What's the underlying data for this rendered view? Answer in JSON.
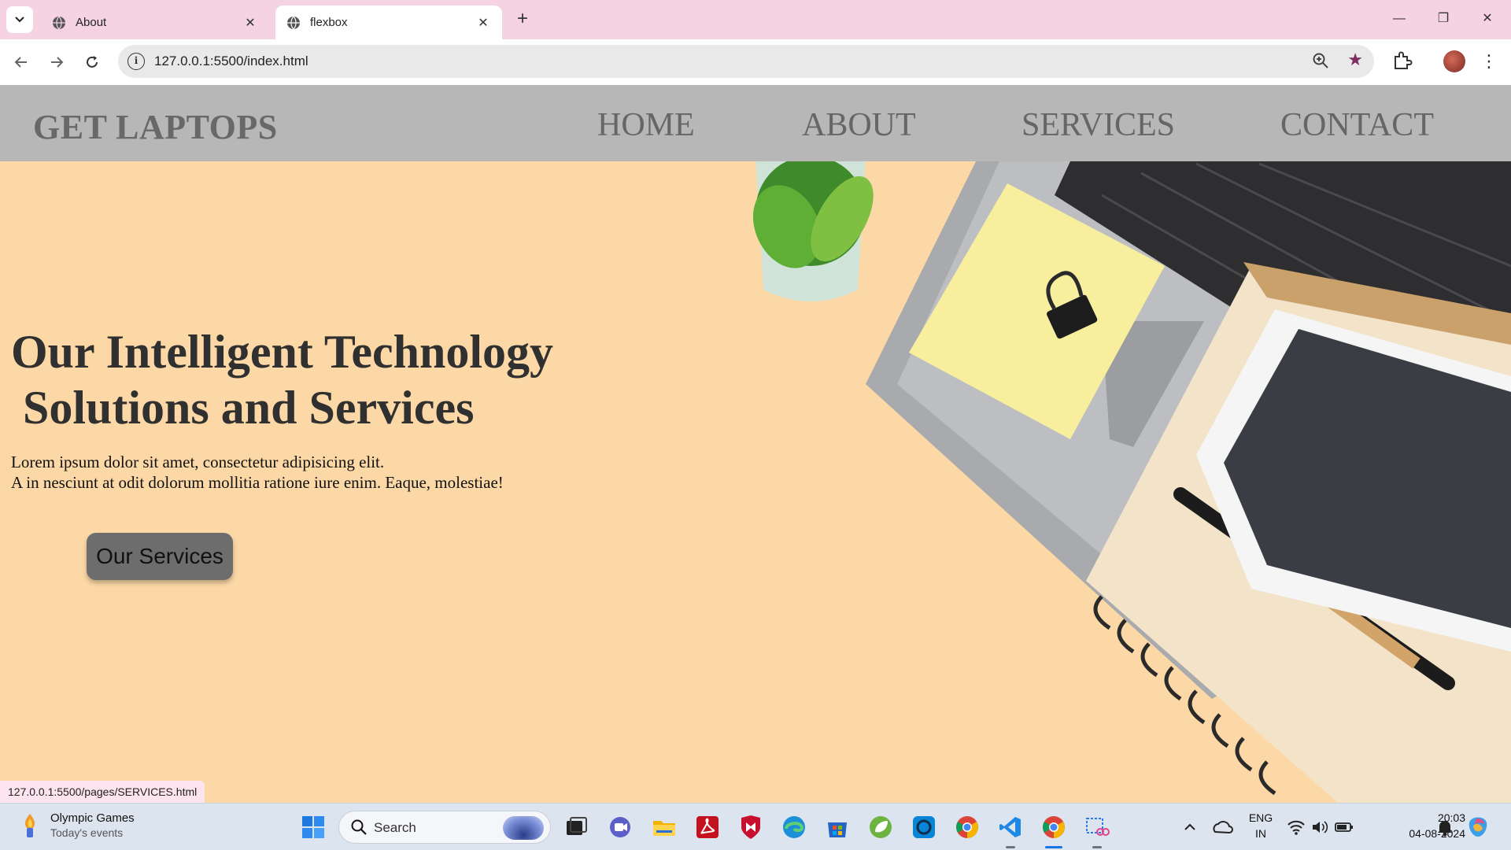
{
  "browser": {
    "tabs": [
      {
        "title": "About",
        "active": false
      },
      {
        "title": "flexbox",
        "active": true
      }
    ],
    "address": "127.0.0.1:5500/index.html",
    "status_url": "127.0.0.1:5500/pages/SERVICES.html"
  },
  "site": {
    "logo": "GET LAPTOPS",
    "nav": [
      "HOME",
      "ABOUT",
      "SERVICES",
      "CONTACT"
    ],
    "headline": [
      "Our Intelligent Technology",
      " Solutions and Services"
    ],
    "lede": [
      "Lorem ipsum dolor sit amet, consectetur adipisicing elit.",
      "A in nesciunt at odit dolorum mollitia ratione iure enim. Eaque, molestiae!"
    ],
    "cta": "Our Services"
  },
  "taskbar": {
    "weather_title": "Olympic Games",
    "weather_sub": "Today's events",
    "search_placeholder": "Search",
    "lang": "ENG",
    "region": "IN",
    "time": "20:03",
    "date": "04-08-2024"
  },
  "colors": {
    "tabbar": "#f5d3e3",
    "page_bg": "#fcd8a6",
    "site_nav": "#b6b7b6",
    "cta_bg": "#6d6d6d",
    "bookmark_star": "#7c2e63"
  }
}
